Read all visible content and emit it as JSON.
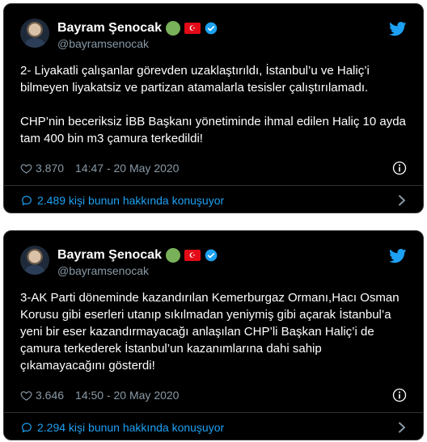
{
  "tweets": [
    {
      "display_name": "Bayram Şenocak",
      "handle": "@bayramsenocak",
      "paragraphs": [
        "2- Liyakatli çalışanlar görevden uzaklaştırıldı, İstanbul’u ve Haliç’i bilmeyen liyakatsiz ve partizan atamalarla tesisler çalıştırılamadı.",
        "CHP’nin beceriksiz İBB Başkanı yönetiminde ihmal edilen Haliç 10 ayda tam 400 bin m3 çamura terkedildi!"
      ],
      "likes": "3.870",
      "time": "14:47 - 20 May 2020",
      "conversation": "2.489 kişi bunun hakkında konuşuyor"
    },
    {
      "display_name": "Bayram Şenocak",
      "handle": "@bayramsenocak",
      "paragraphs": [
        "3-AK Parti döneminde kazandırılan Kemerburgaz Ormanı,Hacı Osman Korusu gibi eserleri utanıp sıkılmadan yeniymiş gibi açarak İstanbul’a yeni bir eser kazandırmayacağı anlaşılan CHP’li Başkan Haliç’i de çamura terkederek İstanbul’un kazanımlarına dahi sahip çıkamayacağını gösterdi!"
      ],
      "likes": "3.646",
      "time": "14:50 - 20 May 2020",
      "conversation": "2.294 kişi bunun hakkında konuşuyor"
    }
  ],
  "icons": {
    "emoji_circle": "green-circle-icon",
    "flag": "turkey-flag-icon",
    "verified": "verified-badge-icon",
    "logo": "twitter-bird-icon",
    "like": "heart-icon",
    "info": "info-icon",
    "reply": "speech-bubble-icon",
    "more": "chevron-right-icon"
  },
  "colors": {
    "background": "#000000",
    "accent": "#1da1f2",
    "secondary_text": "#8899a6",
    "border": "#2f3336"
  }
}
